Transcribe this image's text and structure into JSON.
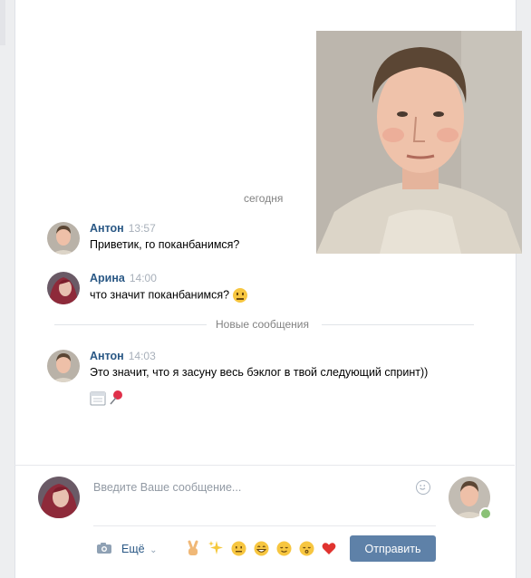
{
  "conversation": {
    "date_label": "сегодня",
    "new_messages_label": "Новые сообщения",
    "messages": [
      {
        "author": "Антон",
        "time": "13:57",
        "text": "Приветик, го поканбанимся?"
      },
      {
        "author": "Арина",
        "time": "14:00",
        "text": "что значит поканбанимся?",
        "emoji": "neutral-face-icon"
      },
      {
        "author": "Антон",
        "time": "14:03",
        "text": "Это значит, что я засуну весь бэклог в твой следующий спринт))",
        "stickers": [
          "calendar-icon",
          "pushpin-icon"
        ]
      }
    ]
  },
  "composer": {
    "placeholder": "Введите Ваше сообщение...",
    "more_label": "Ещё",
    "send_label": "Отправить",
    "emojis": [
      "victory-hand-icon",
      "sparkles-icon",
      "neutral-face-icon",
      "grinning-face-icon",
      "relieved-face-icon",
      "kissing-face-icon",
      "heart-icon"
    ]
  },
  "colors": {
    "link": "#2a5885",
    "button": "#5e81a8",
    "online": "#8ac176"
  }
}
